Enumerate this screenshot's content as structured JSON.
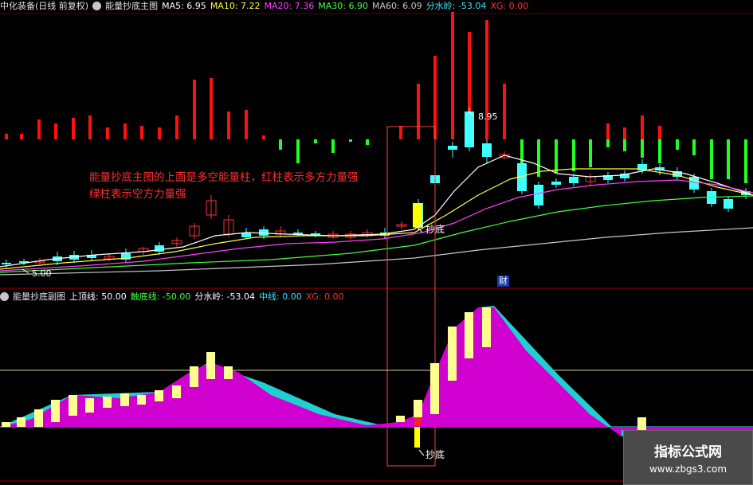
{
  "header": {
    "stock": "中化装备(日线 前复权)",
    "indicator": "能量抄底主图",
    "items": [
      {
        "label": "MA5: 6.95",
        "color": "#ffffff"
      },
      {
        "label": "MA10: 7.22",
        "color": "#ffff40"
      },
      {
        "label": "MA20: 7.36",
        "color": "#ff40ff"
      },
      {
        "label": "MA30: 6.90",
        "color": "#40ff40"
      },
      {
        "label": "MA60: 6.09",
        "color": "#c8c8c8"
      },
      {
        "label": "分水岭: -53.04",
        "color": "#40e0ff"
      },
      {
        "label": "XG: 0.00",
        "color": "#ff3030"
      }
    ]
  },
  "subheader": {
    "indicator": "能量抄底副图",
    "items": [
      {
        "label": "上顶线: 50.00",
        "color": "#ffffff"
      },
      {
        "label": "触底线: -50.00",
        "color": "#40ff40"
      },
      {
        "label": "分水岭: -53.04",
        "color": "#ffffff"
      },
      {
        "label": "中线: 0.00",
        "color": "#40e0ff"
      },
      {
        "label": "XG: 0.00",
        "color": "#ff3030"
      }
    ]
  },
  "main_chart": {
    "high_label": "8.95",
    "low_label": "5.00",
    "signal_label": "抄底",
    "fin_badge": "财",
    "annotation_line1": "能量抄底主图的上面是多空能量柱，红柱表示多方力量强",
    "annotation_line2": "绿柱表示空方力量强"
  },
  "sub_chart": {
    "signal_label": "抄底"
  },
  "watermark": {
    "line1": "指标公式网",
    "line2": "www.zbgs3.com"
  },
  "colors": {
    "up": "#ff3030",
    "down": "#40ffff",
    "signal": "#ffff00",
    "magenta": "#d000d0",
    "cyan": "#20d0d0",
    "bull_bar": "#ff1010",
    "bear_bar": "#20ff20",
    "sub_bar": "#ffff90"
  }
}
